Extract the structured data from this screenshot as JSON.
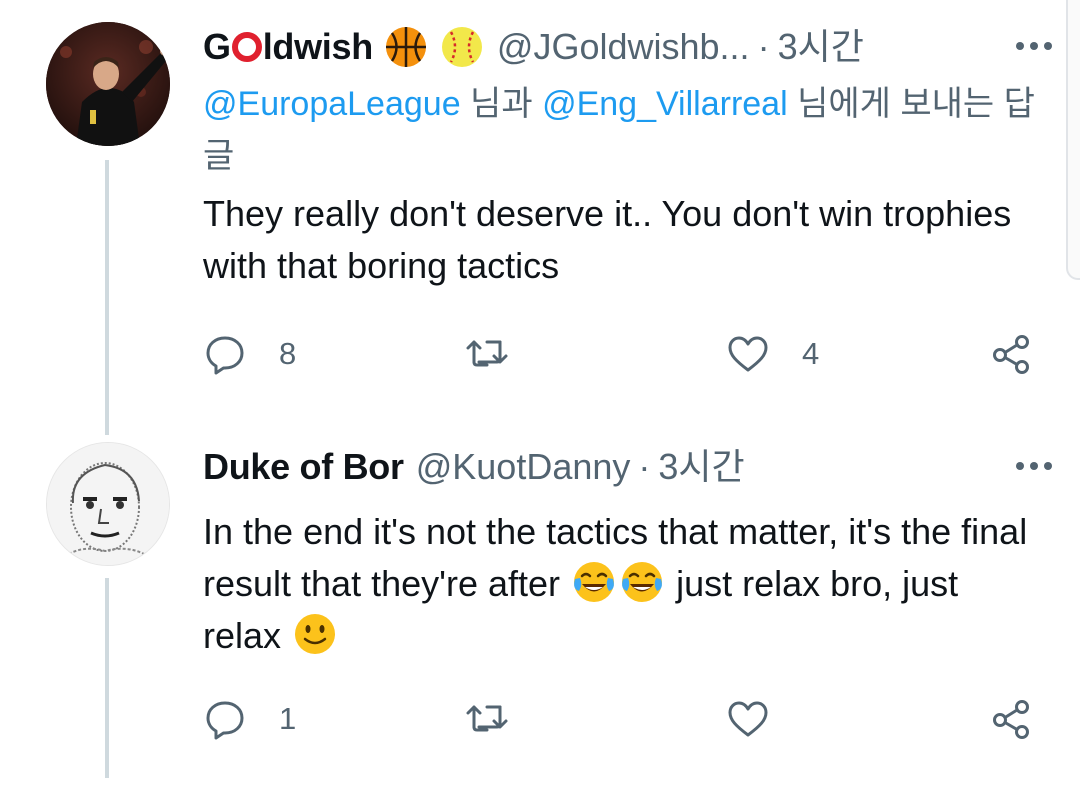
{
  "tweets": [
    {
      "display_name_prefix": "G",
      "display_name_suffix": "ldwish",
      "name_emojis": [
        "basketball-icon",
        "softball-icon"
      ],
      "handle": "@JGoldwishb...",
      "separator": "·",
      "time": "3시간",
      "reply_mention_1": "@EuropaLeague",
      "reply_word_and": " 님과 ",
      "reply_mention_2": "@Eng_Villarreal",
      "reply_suffix": " 님에게 보내는 답글",
      "text": "They really don't deserve it.. You don't win trophies with that boring tactics",
      "reply_count": "8",
      "retweet_count": "",
      "like_count": "4"
    },
    {
      "display_name": "Duke of Bor",
      "handle": "@KuotDanny",
      "separator": "·",
      "time": "3시간",
      "text_part1": "In the end it's not the tactics that matter, it's the final result that they're after ",
      "text_part2": " just relax bro, just relax ",
      "text_emojis": [
        "tears-of-joy-emoji",
        "tears-of-joy-emoji",
        "slightly-smiling-emoji"
      ],
      "reply_count": "1",
      "retweet_count": "",
      "like_count": ""
    }
  ],
  "colors": {
    "link": "#1d9bf0",
    "secondary_text": "#536471",
    "primary_text": "#0f1419",
    "thread_line": "#cfd9de",
    "brand_red": "#e0202e"
  }
}
